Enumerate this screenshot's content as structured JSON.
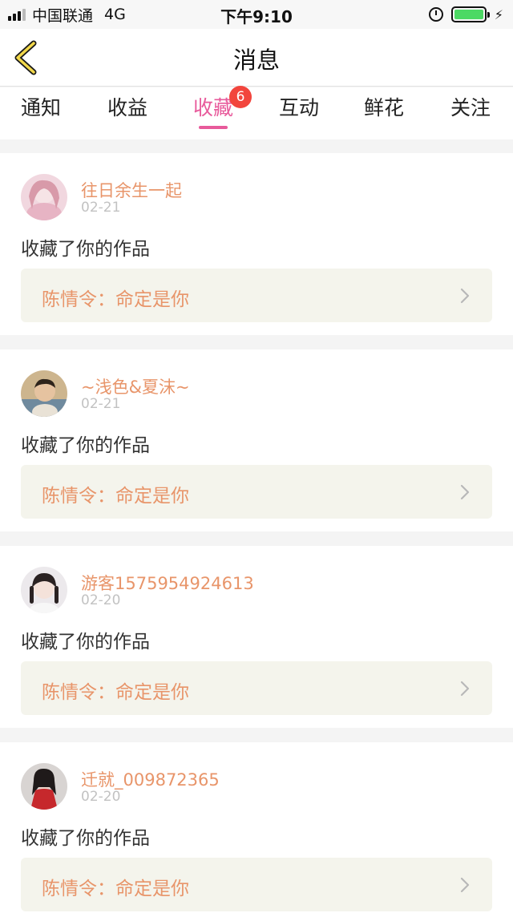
{
  "status_bar": {
    "carrier": "中国联通",
    "network": "4G",
    "time": "下午9:10",
    "battery_color": "#4cd964"
  },
  "header": {
    "back_icon": "chevron-left-icon",
    "title": "消息"
  },
  "tabs": [
    {
      "label": "通知",
      "active": false
    },
    {
      "label": "收益",
      "active": false
    },
    {
      "label": "收藏",
      "active": true,
      "badge": "6"
    },
    {
      "label": "互动",
      "active": false
    },
    {
      "label": "鲜花",
      "active": false
    },
    {
      "label": "关注",
      "active": false
    }
  ],
  "accent_color": "#e85a9b",
  "badge_color": "#f2453d",
  "name_color": "#e8956a",
  "messages": [
    {
      "username": "往日余生一起",
      "date": "02-21",
      "action": "收藏了你的作品",
      "work": "陈情令：命定是你",
      "avatar": "avatar-pink-girl"
    },
    {
      "username": "~浅色&夏沫~",
      "date": "02-21",
      "action": "收藏了你的作品",
      "work": "陈情令：命定是你",
      "avatar": "avatar-child"
    },
    {
      "username": "游客1575954924613",
      "date": "02-20",
      "action": "收藏了你的作品",
      "work": "陈情令：命定是你",
      "avatar": "avatar-girl-braids"
    },
    {
      "username": "迁就_009872365",
      "date": "02-20",
      "action": "收藏了你的作品",
      "work": "陈情令：命定是你",
      "avatar": "avatar-red-dress"
    }
  ]
}
